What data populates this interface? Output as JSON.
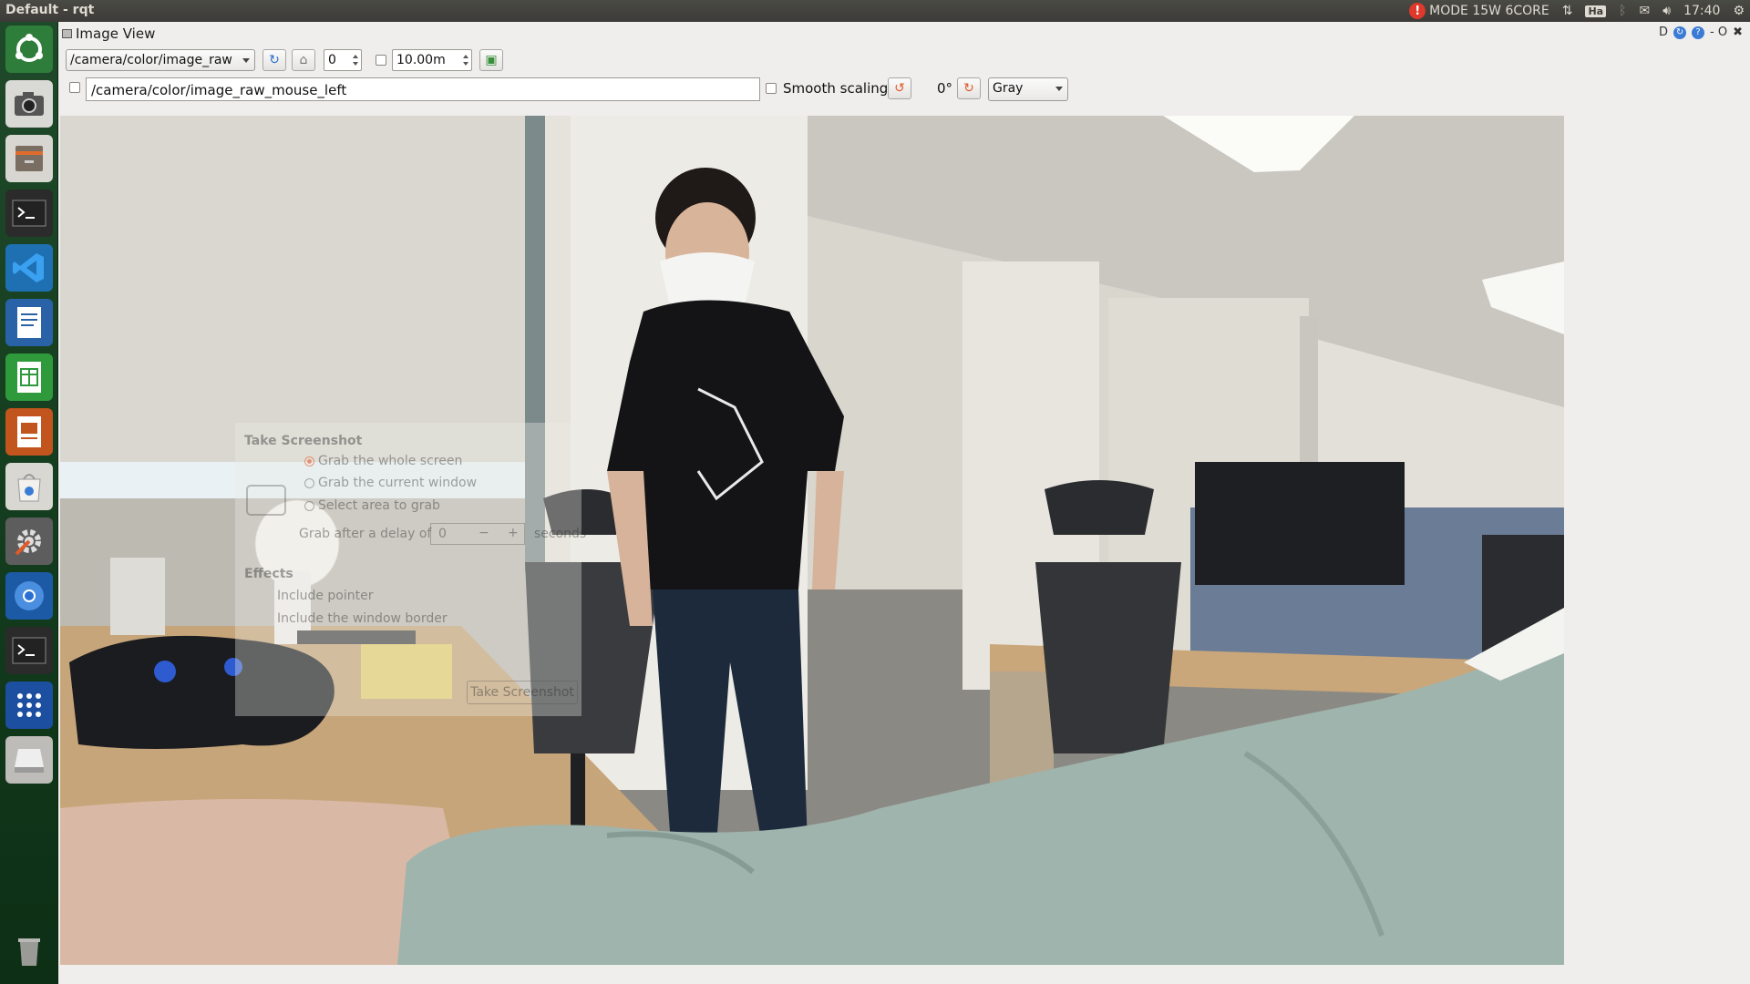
{
  "topbar": {
    "title": "Default - rqt",
    "mode": "MODE 15W 6CORE",
    "keyboard": "Ha",
    "clock": "17:40"
  },
  "launcher": {
    "items": [
      "ubuntu-logo-icon",
      "camera-icon",
      "file-manager-icon",
      "terminal-icon",
      "vscode-icon",
      "writer-icon",
      "calc-icon",
      "impress-icon",
      "software-center-icon",
      "settings-icon",
      "chromium-icon",
      "terminal-icon",
      "apps-grid-icon",
      "drive-icon",
      "trash-icon"
    ]
  },
  "plugin": {
    "title": "Image View",
    "controls_text": "D",
    "controls_right": "- O"
  },
  "toolbar": {
    "topic": "/camera/color/image_raw",
    "spin_value": "0",
    "max_value": "10.00m",
    "mouse_topic": "/camera/color/image_raw_mouse_left",
    "smooth_scaling_label": "Smooth scaling",
    "rotation": "0°",
    "colormap": "Gray"
  },
  "ghost_dialog": {
    "title": "Take Screenshot",
    "options": [
      "Grab the whole screen",
      "Grab the current window",
      "Select area to grab"
    ],
    "delay_label": "Grab after a delay of",
    "delay_value": "0",
    "delay_unit": "seconds",
    "effects_title": "Effects",
    "effects": [
      "Include pointer",
      "Include the window border"
    ],
    "button": "Take Screenshot"
  },
  "colors": {
    "launcher_bg": "#123a1c",
    "panel_bg": "#3c3b37",
    "alert": "#df382c"
  }
}
